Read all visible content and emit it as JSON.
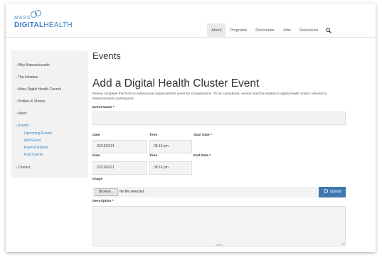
{
  "logo": {
    "mass": "MASS",
    "digital": "DIGITAL",
    "health": "HEALTH"
  },
  "nav": {
    "items": [
      "About",
      "Programs",
      "Directories",
      "Jobs",
      "Resources"
    ],
    "active": "About",
    "search_icon": "search-icon"
  },
  "sidebar": {
    "items": [
      "Why Massachusetts",
      "The Initiative",
      "Mass Digital Health Council",
      "Profiles & Stories",
      "News",
      "Events",
      "Contact"
    ],
    "active": "Events",
    "sub_items": [
      "Upcoming Events",
      "Add Event",
      "Event Partners",
      "Past Events"
    ]
  },
  "main": {
    "page_title": "Events",
    "form_title": "Add a Digital Health Cluster Event",
    "intro": "Please complete this form to submit your organization's event for consideration. To be considered, events must be related to digital health and/or relevant to Massachusetts participants.",
    "event_name_label": "Event Name *",
    "event_name_value": "",
    "start": {
      "date_label": "Date",
      "time_label": "Time",
      "field_label": "Start Date *",
      "date_value": "02/10/2021",
      "time_value": "08:16 pm"
    },
    "end": {
      "date_label": "Date",
      "time_label": "Time",
      "field_label": "End Date *",
      "date_value": "02/10/2021",
      "time_value": "08:16 pm"
    },
    "image_label": "Image",
    "browse_label": "Browse...",
    "file_status": "No file selected.",
    "upload_label": "Upload",
    "description_label": "Description *",
    "description_value": ""
  },
  "colors": {
    "accent": "#3d78b0",
    "link": "#2f7fbf",
    "sidebar_bg": "#f2f2f2",
    "input_bg": "#f3f3f3"
  }
}
